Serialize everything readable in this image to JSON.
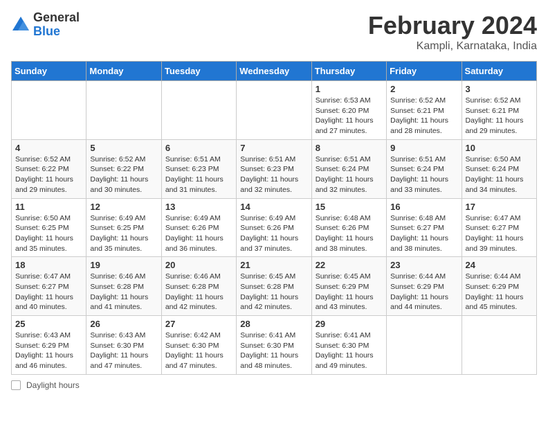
{
  "logo": {
    "general": "General",
    "blue": "Blue"
  },
  "title": "February 2024",
  "subtitle": "Kampli, Karnataka, India",
  "days_of_week": [
    "Sunday",
    "Monday",
    "Tuesday",
    "Wednesday",
    "Thursday",
    "Friday",
    "Saturday"
  ],
  "weeks": [
    [
      {
        "day": "",
        "info": ""
      },
      {
        "day": "",
        "info": ""
      },
      {
        "day": "",
        "info": ""
      },
      {
        "day": "",
        "info": ""
      },
      {
        "day": "1",
        "info": "Sunrise: 6:53 AM\nSunset: 6:20 PM\nDaylight: 11 hours and 27 minutes."
      },
      {
        "day": "2",
        "info": "Sunrise: 6:52 AM\nSunset: 6:21 PM\nDaylight: 11 hours and 28 minutes."
      },
      {
        "day": "3",
        "info": "Sunrise: 6:52 AM\nSunset: 6:21 PM\nDaylight: 11 hours and 29 minutes."
      }
    ],
    [
      {
        "day": "4",
        "info": "Sunrise: 6:52 AM\nSunset: 6:22 PM\nDaylight: 11 hours and 29 minutes."
      },
      {
        "day": "5",
        "info": "Sunrise: 6:52 AM\nSunset: 6:22 PM\nDaylight: 11 hours and 30 minutes."
      },
      {
        "day": "6",
        "info": "Sunrise: 6:51 AM\nSunset: 6:23 PM\nDaylight: 11 hours and 31 minutes."
      },
      {
        "day": "7",
        "info": "Sunrise: 6:51 AM\nSunset: 6:23 PM\nDaylight: 11 hours and 32 minutes."
      },
      {
        "day": "8",
        "info": "Sunrise: 6:51 AM\nSunset: 6:24 PM\nDaylight: 11 hours and 32 minutes."
      },
      {
        "day": "9",
        "info": "Sunrise: 6:51 AM\nSunset: 6:24 PM\nDaylight: 11 hours and 33 minutes."
      },
      {
        "day": "10",
        "info": "Sunrise: 6:50 AM\nSunset: 6:24 PM\nDaylight: 11 hours and 34 minutes."
      }
    ],
    [
      {
        "day": "11",
        "info": "Sunrise: 6:50 AM\nSunset: 6:25 PM\nDaylight: 11 hours and 35 minutes."
      },
      {
        "day": "12",
        "info": "Sunrise: 6:49 AM\nSunset: 6:25 PM\nDaylight: 11 hours and 35 minutes."
      },
      {
        "day": "13",
        "info": "Sunrise: 6:49 AM\nSunset: 6:26 PM\nDaylight: 11 hours and 36 minutes."
      },
      {
        "day": "14",
        "info": "Sunrise: 6:49 AM\nSunset: 6:26 PM\nDaylight: 11 hours and 37 minutes."
      },
      {
        "day": "15",
        "info": "Sunrise: 6:48 AM\nSunset: 6:26 PM\nDaylight: 11 hours and 38 minutes."
      },
      {
        "day": "16",
        "info": "Sunrise: 6:48 AM\nSunset: 6:27 PM\nDaylight: 11 hours and 38 minutes."
      },
      {
        "day": "17",
        "info": "Sunrise: 6:47 AM\nSunset: 6:27 PM\nDaylight: 11 hours and 39 minutes."
      }
    ],
    [
      {
        "day": "18",
        "info": "Sunrise: 6:47 AM\nSunset: 6:27 PM\nDaylight: 11 hours and 40 minutes."
      },
      {
        "day": "19",
        "info": "Sunrise: 6:46 AM\nSunset: 6:28 PM\nDaylight: 11 hours and 41 minutes."
      },
      {
        "day": "20",
        "info": "Sunrise: 6:46 AM\nSunset: 6:28 PM\nDaylight: 11 hours and 42 minutes."
      },
      {
        "day": "21",
        "info": "Sunrise: 6:45 AM\nSunset: 6:28 PM\nDaylight: 11 hours and 42 minutes."
      },
      {
        "day": "22",
        "info": "Sunrise: 6:45 AM\nSunset: 6:29 PM\nDaylight: 11 hours and 43 minutes."
      },
      {
        "day": "23",
        "info": "Sunrise: 6:44 AM\nSunset: 6:29 PM\nDaylight: 11 hours and 44 minutes."
      },
      {
        "day": "24",
        "info": "Sunrise: 6:44 AM\nSunset: 6:29 PM\nDaylight: 11 hours and 45 minutes."
      }
    ],
    [
      {
        "day": "25",
        "info": "Sunrise: 6:43 AM\nSunset: 6:29 PM\nDaylight: 11 hours and 46 minutes."
      },
      {
        "day": "26",
        "info": "Sunrise: 6:43 AM\nSunset: 6:30 PM\nDaylight: 11 hours and 47 minutes."
      },
      {
        "day": "27",
        "info": "Sunrise: 6:42 AM\nSunset: 6:30 PM\nDaylight: 11 hours and 47 minutes."
      },
      {
        "day": "28",
        "info": "Sunrise: 6:41 AM\nSunset: 6:30 PM\nDaylight: 11 hours and 48 minutes."
      },
      {
        "day": "29",
        "info": "Sunrise: 6:41 AM\nSunset: 6:30 PM\nDaylight: 11 hours and 49 minutes."
      },
      {
        "day": "",
        "info": ""
      },
      {
        "day": "",
        "info": ""
      }
    ]
  ],
  "footer": {
    "daylight_label": "Daylight hours"
  }
}
